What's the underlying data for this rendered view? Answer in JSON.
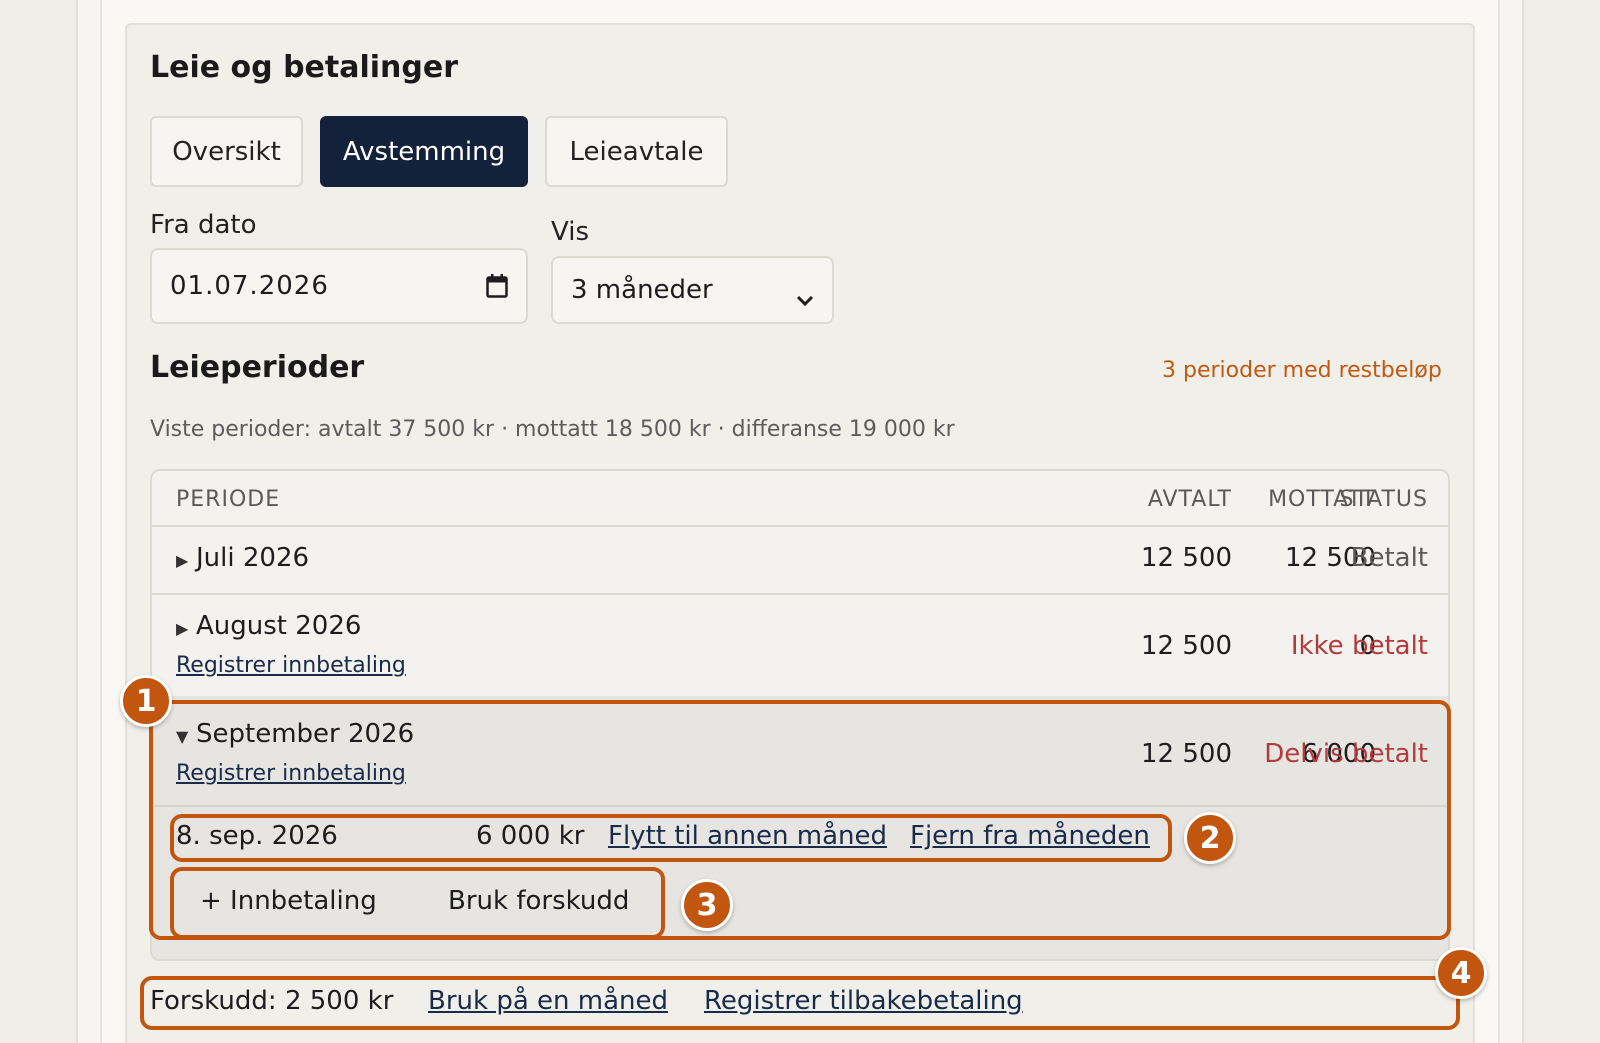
{
  "header": {
    "title": "Leie og betalinger"
  },
  "tabs": [
    {
      "label": "Oversikt",
      "active": false
    },
    {
      "label": "Avstemming",
      "active": true
    },
    {
      "label": "Leieavtale",
      "active": false
    }
  ],
  "filters": {
    "from_date_label": "Fra dato",
    "from_date_value": "01.07.2026",
    "show_label": "Vis",
    "show_value": "3 måneder"
  },
  "periods": {
    "title": "Leieperioder",
    "warning": "3 perioder med restbeløp",
    "summary": "Viste perioder: avtalt 37 500 kr · mottatt 18 500 kr · differanse 19 000 kr",
    "columns": {
      "period": "PERIODE",
      "agreed": "AVTALT",
      "received": "MOTTATT",
      "status": "STATUS"
    },
    "rows": [
      {
        "period": "Juli 2026",
        "agreed": "12 500",
        "received": "12 500",
        "status": "Betalt",
        "expanded": false
      },
      {
        "period": "August 2026",
        "agreed": "12 500",
        "received": "0",
        "status": "Ikke betalt",
        "link": "Registrer innbetaling",
        "expanded": false
      },
      {
        "period": "September 2026",
        "agreed": "12 500",
        "received": "6 000",
        "status": "Delvis betalt",
        "link": "Registrer innbetaling",
        "expanded": true
      }
    ],
    "payment": {
      "date": "8. sep. 2026",
      "amount": "6 000 kr",
      "move_link": "Flytt til annen måned",
      "remove_link": "Fjern fra måneden"
    },
    "actions": {
      "add_payment": "+ Innbetaling",
      "use_advance": "Bruk forskudd"
    }
  },
  "advance": {
    "label": "Forskudd: 2 500 kr",
    "use_link": "Bruk på en måned",
    "refund_link": "Registrer tilbakebetaling"
  },
  "annotations": [
    "1",
    "2",
    "3",
    "4"
  ],
  "colors": {
    "accent": "#c3560f",
    "primary": "#14213a",
    "danger": "#b23b3b"
  },
  "icons": {
    "calendar": "calendar-icon",
    "dropdown": "chevron-down-icon",
    "expand": "caret-icon"
  }
}
